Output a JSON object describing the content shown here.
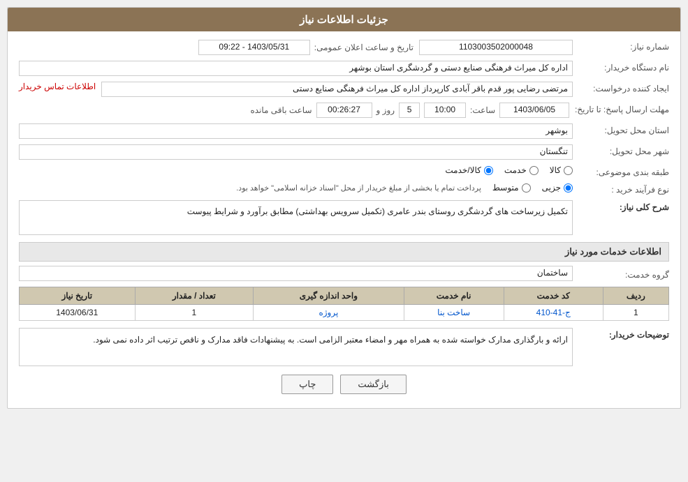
{
  "page": {
    "title": "جزئیات اطلاعات نیاز"
  },
  "fields": {
    "need_number_label": "شماره نیاز:",
    "need_number_value": "1103003502000048",
    "buyer_org_label": "نام دستگاه خریدار:",
    "buyer_org_value": "اداره کل میراث فرهنگی  صنایع دستی و گردشگری استان بوشهر",
    "creator_label": "ایجاد کننده درخواست:",
    "creator_value": "مرتضی رضایی پور قدم باقر آبادی کارپرداز اداره کل میراث فرهنگی  صنایع دستی",
    "contact_link": "اطلاعات تماس خریدار",
    "deadline_label": "مهلت ارسال پاسخ: تا تاریخ:",
    "deadline_date": "1403/06/05",
    "deadline_time_label": "ساعت:",
    "deadline_time": "10:00",
    "deadline_days_label": "روز و",
    "deadline_days": "5",
    "deadline_remaining_label": "ساعت باقی مانده",
    "deadline_remaining": "00:26:27",
    "announce_label": "تاریخ و ساعت اعلان عمومی:",
    "announce_value": "1403/05/31 - 09:22",
    "province_label": "استان محل تحویل:",
    "province_value": "بوشهر",
    "city_label": "شهر محل تحویل:",
    "city_value": "تنگستان",
    "category_label": "طبقه بندی موضوعی:",
    "category_options": [
      "کالا",
      "خدمت",
      "کالا/خدمت"
    ],
    "category_selected": "کالا/خدمت",
    "purchase_type_label": "نوع فرآیند خرید :",
    "purchase_type_options": [
      "جزیی",
      "متوسط"
    ],
    "purchase_type_note": "پرداخت تمام یا بخشی از مبلغ خریدار از محل \"اسناد خزانه اسلامی\" خواهد بود.",
    "need_desc_label": "شرح کلی نیاز:",
    "need_desc_value": "تکمیل زیرساخت های گردشگری روستای بندر عامری (تکمیل سرویس بهداشتی) مطابق برآورد و شرایط پیوست",
    "services_section_title": "اطلاعات خدمات مورد نیاز",
    "service_group_label": "گروه خدمت:",
    "service_group_value": "ساختمان",
    "table_headers": [
      "ردیف",
      "کد خدمت",
      "نام خدمت",
      "واحد اندازه گیری",
      "تعداد / مقدار",
      "تاریخ نیاز"
    ],
    "table_rows": [
      {
        "row_num": "1",
        "service_code": "ج-41-410",
        "service_name": "ساخت بنا",
        "unit": "پروژه",
        "quantity": "1",
        "date": "1403/06/31"
      }
    ],
    "buyer_notes_label": "توضیحات خریدار:",
    "buyer_notes_value": "ارائه و بارگذاری مدارک خواسته شده به همراه مهر و امضاء معتبر الزامی است. به پیشنهادات فاقد مدارک و ناقص ترتیب اثر داده نمی شود.",
    "back_button": "بازگشت",
    "print_button": "چاپ"
  }
}
